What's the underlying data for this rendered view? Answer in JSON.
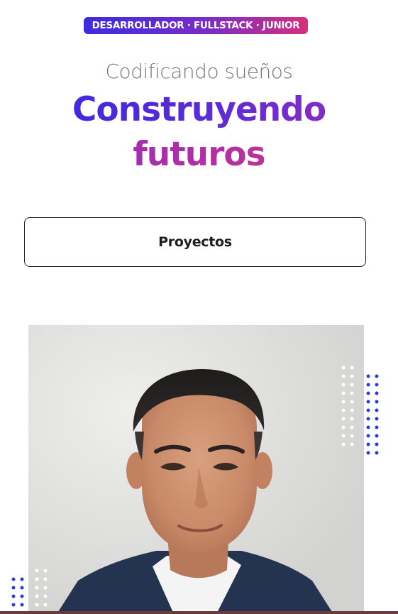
{
  "hero": {
    "badge": "DESARROLLADOR · FULLSTACK · JUNIOR",
    "subtitle": "Codificando sueños",
    "headline_line1": "Construyendo",
    "headline_line2": "futuros",
    "projects_button": "Proyectos"
  },
  "colors": {
    "accent_blue": "#3229e6",
    "accent_purple": "#9a2cbd",
    "accent_pink": "#d63784",
    "dots_blue": "#2a3ce0",
    "dots_white": "#ffffff"
  },
  "profile_photo": {
    "alt": "",
    "icon": "portrait-photo"
  }
}
